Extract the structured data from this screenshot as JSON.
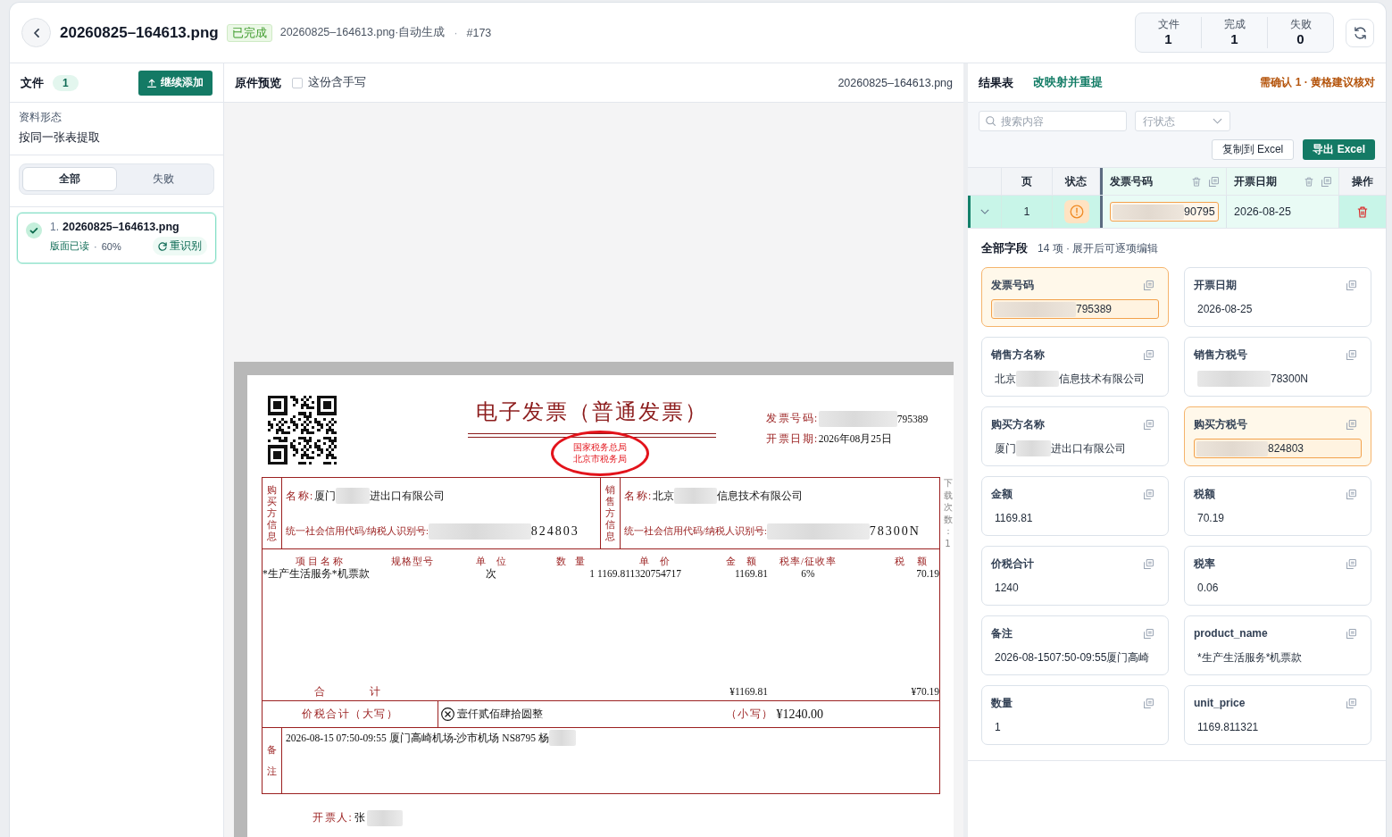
{
  "header": {
    "title": "20260825–164613.png",
    "status": "已完成",
    "subtitle": "20260825–164613.png·自动生成",
    "separator": "·",
    "run_number": "#173",
    "stats": [
      {
        "label": "文件",
        "value": "1"
      },
      {
        "label": "完成",
        "value": "1"
      },
      {
        "label": "失败",
        "value": "0"
      }
    ]
  },
  "files_panel": {
    "title": "文件",
    "count": "1",
    "add_button": "继续添加",
    "mode_label": "资料形态",
    "mode_value": "按同一张表提取",
    "filter_tabs": [
      {
        "label": "全部",
        "selected": true
      },
      {
        "label": "失败",
        "selected": false
      }
    ],
    "files": [
      {
        "index": "1.",
        "name": "20260825–164613.png",
        "done": true,
        "selected": true,
        "progress": "版面已读",
        "separator": "·",
        "percent": "60%",
        "rerun_button": "重识别"
      }
    ]
  },
  "preview_panel": {
    "title": "原件预览",
    "handwriting": {
      "label": "这份含手写",
      "checked": false
    },
    "file_name": "20260825–164613.png",
    "invoice": {
      "title": "电子发票（普通发票）",
      "seal": [
        "国家税务总局",
        "北京市税务局"
      ],
      "number_label": "发票号码:",
      "number": [
        {
          "kind": "redacted"
        },
        {
          "kind": "text",
          "text": "795389"
        }
      ],
      "date_label": "开票日期:",
      "date": "2026年08月25日",
      "side_note": "下载次数：1",
      "buyer": {
        "heading": "购买方信息",
        "name_label": "名称:",
        "name": [
          {
            "kind": "text",
            "text": "厦门"
          },
          {
            "kind": "redacted"
          },
          {
            "kind": "text",
            "text": "进出口有限公司"
          }
        ],
        "tax_label": "统一社会信用代码/纳税人识别号:",
        "tax_id": [
          {
            "kind": "redacted"
          },
          {
            "kind": "text",
            "text": "824803"
          }
        ]
      },
      "seller": {
        "heading": "销售方信息",
        "name_label": "名称:",
        "name": [
          {
            "kind": "text",
            "text": "北京"
          },
          {
            "kind": "redacted"
          },
          {
            "kind": "text",
            "text": "信息技术有限公司"
          }
        ],
        "tax_label": "统一社会信用代码/纳税人识别号:",
        "tax_id": [
          {
            "kind": "redacted"
          },
          {
            "kind": "text",
            "text": "78300N"
          }
        ]
      },
      "item_columns": [
        "项目名称",
        "规格型号",
        "单位",
        "数量",
        "单价",
        "金额",
        "税率/征收率",
        "税额"
      ],
      "items": [
        {
          "name": "*生产生活服务*机票款",
          "unit": "次",
          "quantity": "1",
          "unit_price": "1169.811320754717",
          "amount": "1169.81",
          "tax_rate": "6%",
          "tax": "70.19"
        }
      ],
      "total_label": "合计",
      "total_amount": "¥1169.81",
      "total_tax": "¥70.19",
      "grand_total_label": "价税合计（大写）",
      "grand_total_words": "壹仟贰佰肆拾圆整",
      "grand_total_small_label": "（小写）",
      "grand_total": "¥1240.00",
      "remarks_label": "备注",
      "remarks": [
        {
          "kind": "text",
          "text": "2026-08-15 07:50-09:55 厦门高崎机场-沙市机场 NS8795 杨"
        },
        {
          "kind": "redacted"
        }
      ],
      "issuer_label": "开票人:",
      "issuer": [
        {
          "kind": "text",
          "text": "张"
        },
        {
          "kind": "redacted"
        }
      ]
    }
  },
  "results_panel": {
    "title": "结果表",
    "remap_link": "改映射并重提",
    "review_note": "需确认 1 · 黄格建议核对",
    "search": {
      "placeholder": "搜索内容"
    },
    "status_filter": {
      "placeholder": "行状态"
    },
    "copy_button": "复制到 Excel",
    "export_button": "导出 Excel",
    "table": {
      "columns": [
        {
          "kind": "expand"
        },
        {
          "label": "页",
          "kind": "meta"
        },
        {
          "label": "状态",
          "kind": "meta"
        },
        {
          "label": "发票号码",
          "kind": "field"
        },
        {
          "label": "开票日期",
          "kind": "field"
        },
        {
          "label": "操作",
          "kind": "action"
        }
      ],
      "rows": [
        {
          "selected": true,
          "cells": [
            {
              "kind": "expand",
              "expanded": true
            },
            {
              "kind": "text",
              "text": "1"
            },
            {
              "kind": "status",
              "needs_review": true
            },
            {
              "kind": "field",
              "flagged": true,
              "value": [
                {
                  "kind": "redacted"
                },
                {
                  "kind": "text",
                  "text": "90795"
                }
              ]
            },
            {
              "kind": "field",
              "flagged": false,
              "value": [
                {
                  "kind": "text",
                  "text": "2026-08-25"
                }
              ]
            },
            {
              "kind": "action"
            }
          ]
        }
      ]
    },
    "fields_title": "全部字段",
    "fields_summary": "14 项 · 展开后可逐项编辑",
    "fields": [
      {
        "label": "发票号码",
        "flagged": true,
        "value": [
          {
            "kind": "redacted"
          },
          {
            "kind": "text",
            "text": "795389"
          }
        ]
      },
      {
        "label": "开票日期",
        "flagged": false,
        "value": [
          {
            "kind": "text",
            "text": "2026-08-25"
          }
        ]
      },
      {
        "label": "销售方名称",
        "flagged": false,
        "value": [
          {
            "kind": "text",
            "text": "北京"
          },
          {
            "kind": "redacted"
          },
          {
            "kind": "text",
            "text": "信息技术有限公司"
          }
        ]
      },
      {
        "label": "销售方税号",
        "flagged": false,
        "value": [
          {
            "kind": "redacted"
          },
          {
            "kind": "text",
            "text": "78300N"
          }
        ]
      },
      {
        "label": "购买方名称",
        "flagged": false,
        "value": [
          {
            "kind": "text",
            "text": "厦门"
          },
          {
            "kind": "redacted"
          },
          {
            "kind": "text",
            "text": "进出口有限公司"
          }
        ]
      },
      {
        "label": "购买方税号",
        "flagged": true,
        "value": [
          {
            "kind": "redacted"
          },
          {
            "kind": "text",
            "text": "824803"
          }
        ]
      },
      {
        "label": "金额",
        "flagged": false,
        "value": [
          {
            "kind": "text",
            "text": "1169.81"
          }
        ]
      },
      {
        "label": "税额",
        "flagged": false,
        "value": [
          {
            "kind": "text",
            "text": "70.19"
          }
        ]
      },
      {
        "label": "价税合计",
        "flagged": false,
        "value": [
          {
            "kind": "text",
            "text": "1240"
          }
        ]
      },
      {
        "label": "税率",
        "flagged": false,
        "value": [
          {
            "kind": "text",
            "text": "0.06"
          }
        ]
      },
      {
        "label": "备注",
        "flagged": false,
        "value": [
          {
            "kind": "text",
            "text": "2026-08-1507:50-09:55厦门高崎"
          }
        ]
      },
      {
        "label": "product_name",
        "flagged": false,
        "value": [
          {
            "kind": "text",
            "text": "*生产生活服务*机票款"
          }
        ]
      },
      {
        "label": "数量",
        "flagged": false,
        "value": [
          {
            "kind": "text",
            "text": "1"
          }
        ]
      },
      {
        "label": "unit_price",
        "flagged": false,
        "value": [
          {
            "kind": "text",
            "text": "1169.811321"
          }
        ]
      }
    ]
  }
}
